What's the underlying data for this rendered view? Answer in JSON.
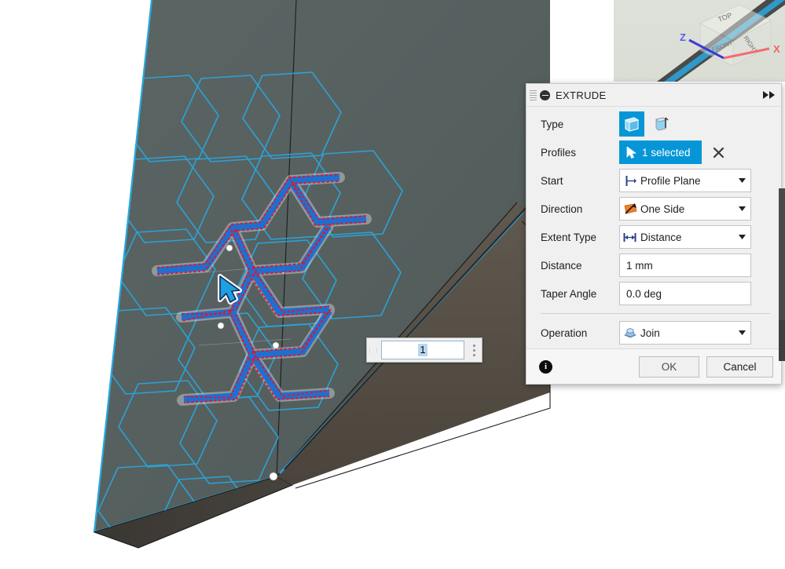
{
  "app": {
    "canvas_background": "#ffffff",
    "body_color": "#56605f",
    "sketch_color": "#29a8e0",
    "accent": "#0696d7"
  },
  "viewcube": {
    "faces": [
      "TOP",
      "RIGHT",
      "FRONT"
    ],
    "axes": [
      {
        "label": "Z",
        "color": "#3b3bd8"
      },
      {
        "label": "X",
        "color": "#f26d6d"
      }
    ]
  },
  "manipulator": {
    "value": "1",
    "menu_icon": "vertical-dots-icon",
    "grip_icon": "drag-grip-icon"
  },
  "dialog": {
    "title": "EXTRUDE",
    "collapse_icon": "minus-circle-icon",
    "grip_icon": "drag-handle-icon",
    "expand_icon": "double-chevron-right-icon",
    "rows": {
      "type": {
        "label": "Type",
        "options": [
          {
            "name": "profile-extrude-icon",
            "selected": true
          },
          {
            "name": "tapered-extrude-icon",
            "selected": false
          }
        ]
      },
      "profiles": {
        "label": "Profiles",
        "value": "1 selected",
        "cursor_icon": "select-arrow-icon",
        "clear_icon": "close-x-icon"
      },
      "start": {
        "label": "Start",
        "value": "Profile Plane",
        "icon": "profile-plane-icon"
      },
      "direction": {
        "label": "Direction",
        "value": "One Side",
        "icon": "one-side-icon"
      },
      "extent_type": {
        "label": "Extent Type",
        "value": "Distance",
        "icon": "distance-icon"
      },
      "distance": {
        "label": "Distance",
        "value": "1 mm"
      },
      "taper_angle": {
        "label": "Taper Angle",
        "value": "0.0 deg"
      },
      "operation": {
        "label": "Operation",
        "value": "Join",
        "icon": "join-icon"
      }
    },
    "footer": {
      "info_icon": "info-icon",
      "info_label": "i",
      "ok_label": "OK",
      "cancel_label": "Cancel"
    }
  },
  "scrollbar": {
    "orientation": "vertical",
    "position": "right-edge"
  }
}
